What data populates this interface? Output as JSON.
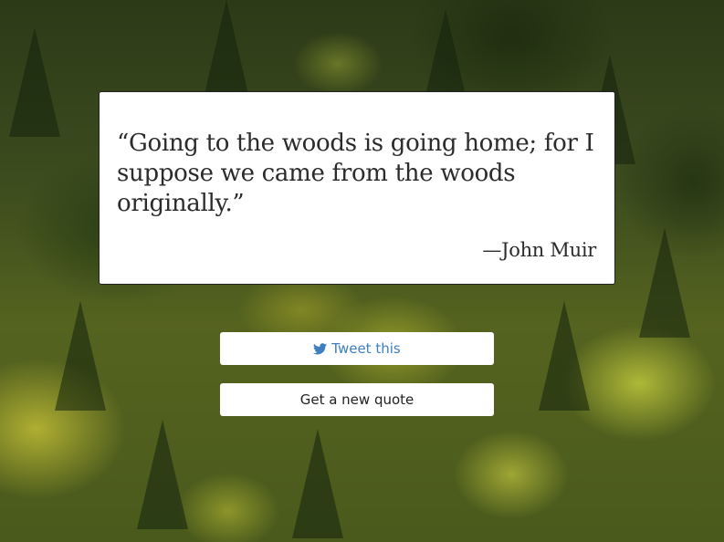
{
  "quote": {
    "text": "“Going to the woods is going home; for I suppose we came from the woods originally.”",
    "author": "—John Muir"
  },
  "buttons": {
    "tweet_label": "Tweet this",
    "tweet_icon": "twitter-bird-icon",
    "new_quote_label": "Get a new quote"
  },
  "colors": {
    "card_background": "#ffffff",
    "text": "#2b2b2b",
    "tweet_accent": "#3d7fc1"
  }
}
